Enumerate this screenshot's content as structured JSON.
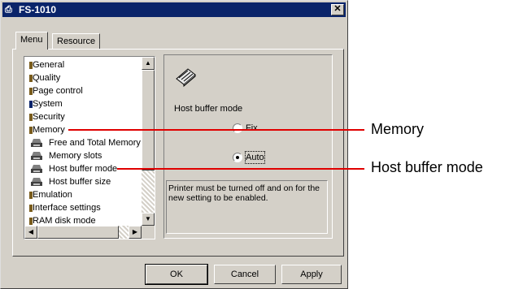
{
  "window": {
    "title": "FS-1010",
    "close_glyph": "✕"
  },
  "tabs": [
    "Menu",
    "Resource"
  ],
  "tree": {
    "items": [
      {
        "label": "General",
        "indent": 0,
        "icon": "bullet"
      },
      {
        "label": "Quality",
        "indent": 0,
        "icon": "bullet"
      },
      {
        "label": "Page control",
        "indent": 0,
        "icon": "bullet"
      },
      {
        "label": "System",
        "indent": 0,
        "icon": "bullet"
      },
      {
        "label": "Security",
        "indent": 0,
        "icon": "bullet"
      },
      {
        "label": "Memory",
        "indent": 0,
        "icon": "bullet"
      },
      {
        "label": "Free and Total Memory",
        "indent": 1,
        "icon": "printer-icon"
      },
      {
        "label": "Memory slots",
        "indent": 1,
        "icon": "printer-icon"
      },
      {
        "label": "Host buffer mode",
        "indent": 1,
        "icon": "printer-icon"
      },
      {
        "label": "Host buffer size",
        "indent": 1,
        "icon": "printer-icon"
      },
      {
        "label": "Emulation",
        "indent": 0,
        "icon": "bullet"
      },
      {
        "label": "Interface settings",
        "indent": 0,
        "icon": "bullet"
      },
      {
        "label": "RAM disk mode",
        "indent": 0,
        "icon": "bullet"
      }
    ]
  },
  "detail": {
    "icon": "memory-chip-icon",
    "heading": "Host buffer mode",
    "options": [
      {
        "label": "Fix",
        "selected": false
      },
      {
        "label": "Auto",
        "selected": true
      }
    ],
    "note": "Printer must be turned off and on for the new setting to be enabled."
  },
  "buttons": {
    "ok": "OK",
    "cancel": "Cancel",
    "apply": "Apply"
  },
  "callouts": [
    "Memory",
    "Host buffer mode"
  ],
  "colors": {
    "titlebar": "#0a246a",
    "dialog": "#d4d0c8",
    "callout_line": "#e00000"
  }
}
